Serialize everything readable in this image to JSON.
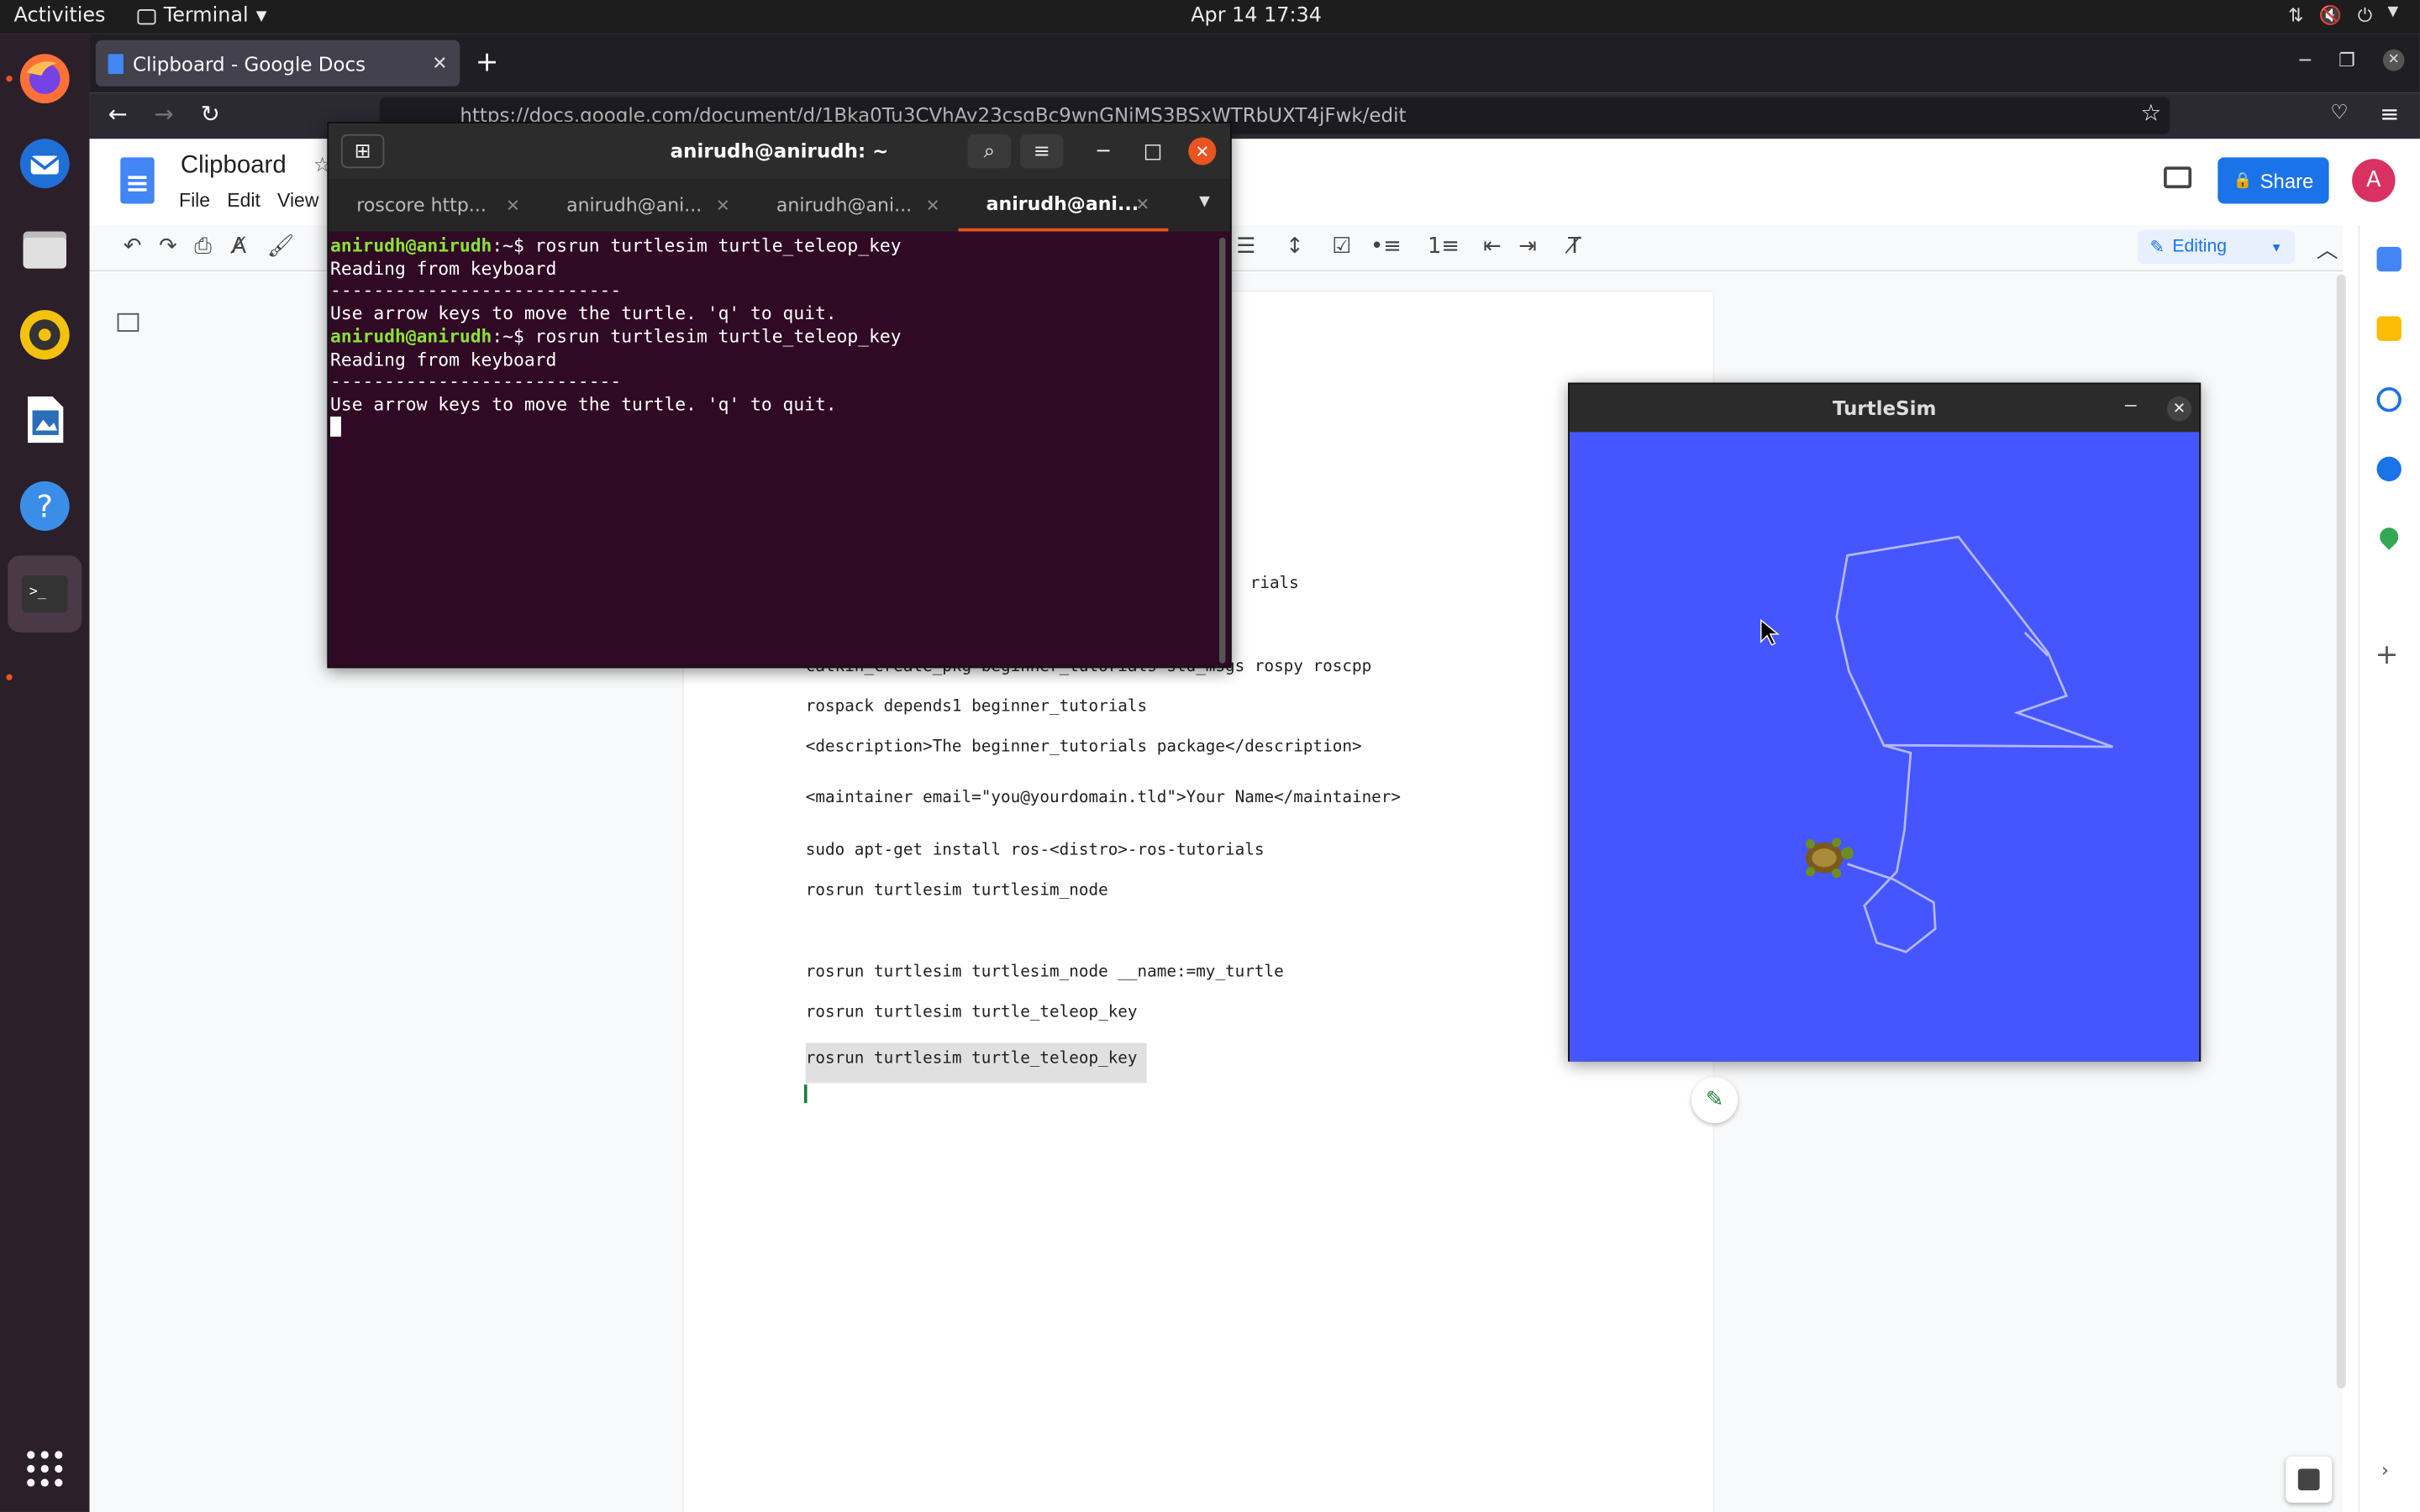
{
  "topbar": {
    "activities": "Activities",
    "app_name": "Terminal",
    "clock": "Apr 14  17:34"
  },
  "dock": {
    "items": [
      "firefox-icon",
      "thunderbird-icon",
      "files-icon",
      "rhythmbox-icon",
      "libreoffice-writer-icon",
      "help-icon",
      "terminal-icon"
    ],
    "apps_grid": "show-applications-icon"
  },
  "browser": {
    "tab_title": "Clipboard - Google Docs",
    "url": "https://docs.google.com/document/d/1Bka0Tu3CVhAy23csqBc9wnGNiMS3BSxWTRbUXT4jFwk/edit"
  },
  "docs": {
    "title": "Clipboard",
    "menu": [
      "File",
      "Edit",
      "View"
    ],
    "share_label": "Share",
    "avatar_letter": "A",
    "mode_label": "Editing",
    "lines": [
      "rials",
      "catkin_create_pkg beginner_tutorials std_msgs rospy roscpp",
      "rospack depends1 beginner_tutorials",
      "<description>The beginner_tutorials package</description>",
      "<maintainer email=\"you@yourdomain.tld\">Your Name</maintainer>",
      "sudo apt-get install ros-<distro>-ros-tutorials",
      "rosrun turtlesim turtlesim_node",
      "rosrun turtlesim turtlesim_node __name:=my_turtle",
      "rosrun turtlesim turtle_teleop_key",
      "rosrun turtlesim turtle_teleop_key"
    ]
  },
  "terminal": {
    "title": "anirudh@anirudh: ~",
    "tabs": [
      "roscore http...",
      "anirudh@ani...",
      "anirudh@ani...",
      "anirudh@ani..."
    ],
    "prompt_user": "anirudh@anirudh",
    "prompt_path": ":~$ ",
    "output": [
      {
        "type": "cmd",
        "text": "rosrun turtlesim turtle_teleop_key"
      },
      {
        "type": "out",
        "text": "Reading from keyboard"
      },
      {
        "type": "out",
        "text": "---------------------------"
      },
      {
        "type": "out",
        "text": "Use arrow keys to move the turtle. 'q' to quit."
      },
      {
        "type": "cmd",
        "text": "rosrun turtlesim turtle_teleop_key"
      },
      {
        "type": "out",
        "text": "Reading from keyboard"
      },
      {
        "type": "out",
        "text": "---------------------------"
      },
      {
        "type": "out",
        "text": "Use arrow keys to move the turtle. 'q' to quit."
      }
    ]
  },
  "turtlesim": {
    "title": "TurtleSim",
    "background_color": "#4556ff",
    "trail_color": "#b3b8ff"
  }
}
